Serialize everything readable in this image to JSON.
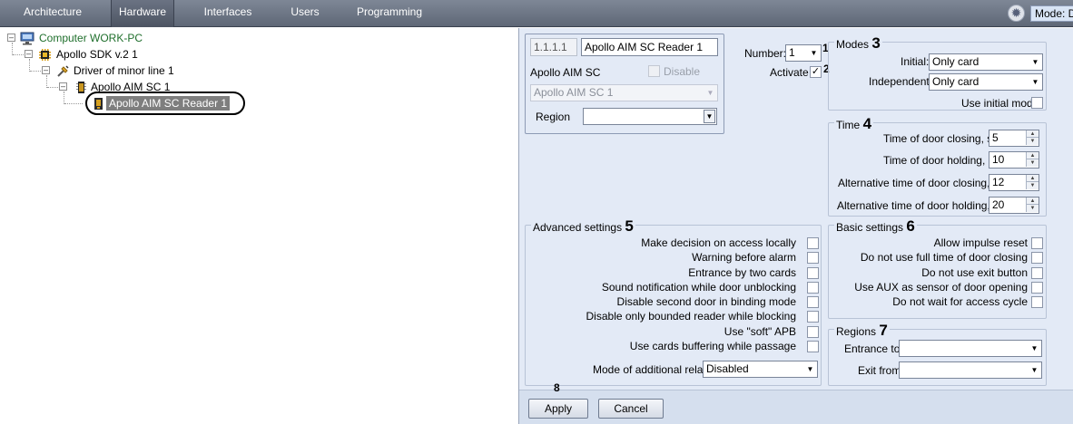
{
  "tabs": [
    {
      "label": "Architecture",
      "active": false
    },
    {
      "label": "Hardware",
      "active": true
    },
    {
      "label": "Interfaces",
      "active": false
    },
    {
      "label": "Users",
      "active": false
    },
    {
      "label": "Programming",
      "active": false
    }
  ],
  "topbar": {
    "mode_label": "Mode: D"
  },
  "tree": {
    "computer": "Computer WORK-PC",
    "sdk": "Apollo SDK v.2 1",
    "driver": "Driver of minor line 1",
    "aim": "Apollo AIM SC 1",
    "reader": "Apollo AIM SC Reader 1"
  },
  "device": {
    "address": "1.1.1.1",
    "name": "Apollo AIM SC Reader 1",
    "type_label": "Apollo AIM SC",
    "disable_label": "Disable",
    "parent_select": "Apollo AIM SC 1",
    "region_label": "Region",
    "region_value": ""
  },
  "number": {
    "label": "Number:",
    "value": "1",
    "marker": "1"
  },
  "activate": {
    "label": "Activate",
    "checked": true,
    "marker": "2"
  },
  "modes": {
    "legend": "Modes",
    "marker": "3",
    "initial_label": "Initial:",
    "initial_value": "Only card",
    "independent_label": "Independent:",
    "independent_value": "Only card",
    "use_initial_label": "Use initial mode"
  },
  "time": {
    "legend": "Time",
    "marker": "4",
    "rows": [
      {
        "label": "Time of door closing, s:",
        "value": "5"
      },
      {
        "label": "Time of door holding, s:",
        "value": "10"
      },
      {
        "label": "Alternative time of door closing, s:",
        "value": "12"
      },
      {
        "label": "Alternative time of door holding, s:",
        "value": "20"
      }
    ]
  },
  "advanced": {
    "legend": "Advanced settings",
    "marker": "5",
    "options": [
      "Make decision on access locally",
      "Warning before alarm",
      "Entrance by two cards",
      "Sound notification while door unblocking",
      "Disable second door in binding mode",
      "Disable only bounded reader while blocking",
      "Use \"soft\" APB",
      "Use cards buffering while passage"
    ],
    "relay_label": "Mode of additional relay:",
    "relay_value": "Disabled"
  },
  "basic": {
    "legend": "Basic settings",
    "marker": "6",
    "options": [
      "Allow impulse reset",
      "Do not use full time of door closing",
      "Do not use exit button",
      "Use AUX as sensor of door opening",
      "Do not wait for access cycle"
    ]
  },
  "regions": {
    "legend": "Regions",
    "marker": "7",
    "entrance_label": "Entrance to:",
    "entrance_value": "",
    "exit_label": "Exit from:",
    "exit_value": ""
  },
  "buttons": {
    "apply": "Apply",
    "cancel": "Cancel",
    "marker": "8"
  },
  "icons": {
    "computer": "computer-icon",
    "sdk": "chip-icon",
    "driver": "driver-icon",
    "aim": "controller-icon",
    "reader": "card-reader-icon",
    "settings": "gear-icon",
    "dropdown": "chevron-down-icon"
  }
}
